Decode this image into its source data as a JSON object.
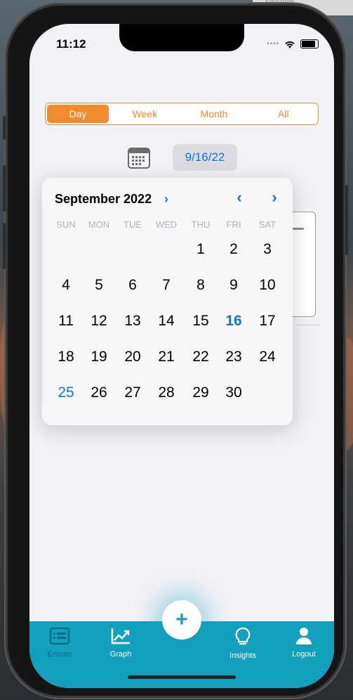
{
  "background": {
    "menu_text": "Favorites"
  },
  "status_bar": {
    "time": "11:12",
    "icons": [
      "cellular-dots-icon",
      "wifi-icon",
      "battery-icon"
    ]
  },
  "segment": {
    "items": [
      "Day",
      "Week",
      "Month",
      "All"
    ],
    "selected": "Day"
  },
  "date_picker": {
    "value": "9/16/22"
  },
  "calendar": {
    "month_label": "September 2022",
    "weekdays": [
      "SUN",
      "MON",
      "TUE",
      "WED",
      "THU",
      "FRI",
      "SAT"
    ],
    "weeks": [
      [
        "",
        "",
        "",
        "",
        "1",
        "2",
        "3"
      ],
      [
        "4",
        "5",
        "6",
        "7",
        "8",
        "9",
        "10"
      ],
      [
        "11",
        "12",
        "13",
        "14",
        "15",
        "16",
        "17"
      ],
      [
        "18",
        "19",
        "20",
        "21",
        "22",
        "23",
        "24"
      ],
      [
        "25",
        "26",
        "27",
        "28",
        "29",
        "30",
        ""
      ]
    ],
    "selected_day": "16",
    "today": "25"
  },
  "tabbar": {
    "items": [
      {
        "label": "Entries",
        "icon": "list-card-icon"
      },
      {
        "label": "Graph",
        "icon": "chart-trend-icon"
      },
      {
        "label": "Insights",
        "icon": "lightbulb-icon"
      },
      {
        "label": "Logout",
        "icon": "person-icon"
      }
    ],
    "fab_label": "+"
  },
  "colors": {
    "accent_orange": "#f28a2e",
    "accent_blue": "#1a73d9",
    "tab_teal": "#13a0bd"
  }
}
